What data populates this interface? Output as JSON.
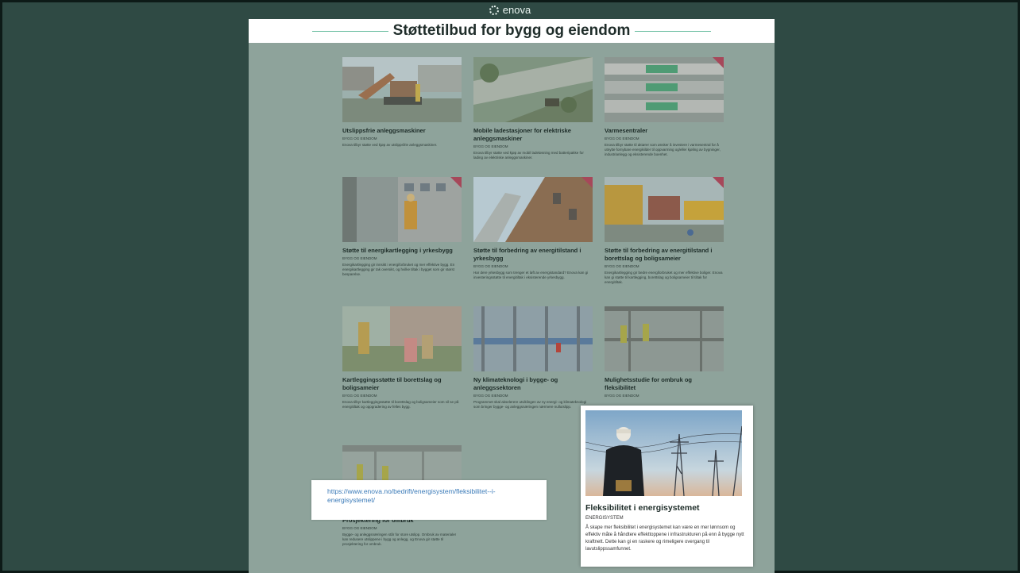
{
  "brand": {
    "name": "enova"
  },
  "page": {
    "title": "Støttetilbud for bygg og eiendom"
  },
  "cards": [
    {
      "title": "Utslippsfrie anleggsmaskiner",
      "category": "BYGG OG EIENDOM",
      "description": "Enova tilbyr støtte ved kjøp av utslippsfrie anleggsmaskiner."
    },
    {
      "title": "Mobile ladestasjoner for elektriske anleggsmaskiner",
      "category": "BYGG OG EIENDOM",
      "description": "Enova tilbyr støtte ved kjøp av mobil ladeløsning med batteripakke for lading av elektriske anleggsmaskiner."
    },
    {
      "title": "Varmesentraler",
      "category": "BYGG OG EIENDOM",
      "description": "Enova tilbyr støtte til aktører som ønsker å investere i varmesentral for å utnytte fornybare energikilder til oppvarming og/eller kjøling av bygninger, industrianlegg og eksisterende boenhet."
    },
    {
      "title": "Støtte til energikartlegging i yrkesbygg",
      "category": "BYGG OG EIENDOM",
      "description": "Energikartlegging gir innsikt i energiforbruket og mer effektive bygg. En energikartlegging gir tak oversikt, og hvilke tiltak i bygget som gir størst besparelse."
    },
    {
      "title": "Støtte til forbedring av energitilstand i yrkesbygg",
      "category": "BYGG OG EIENDOM",
      "description": "Har dere yrkesbygg som trenger et løft av energistandard? Enova kan gi investeringsstøtte til energitiltak i eksisterende yrkesbygg."
    },
    {
      "title": "Støtte til forbedring av energitilstand i borettslag og boligsameier",
      "category": "BYGG OG EIENDOM",
      "description": "Energikartlegging gir bedre energiforbruket og mer effektive boliger. Enova kan gi støtte til kartlegging, borettslag og boligsameier til tiltak for energitiltak."
    },
    {
      "title": "Kartleggingsstøtte til borettslag og boligsameier",
      "category": "BYGG OG EIENDOM",
      "description": "Enova tilbyr kartleggingsstøtte til borettslag og boligsameier som vil se på energitiltak og oppgradering av felles bygg."
    },
    {
      "title": "Ny klimateknologi i bygge- og anleggssektoren",
      "category": "BYGG OG EIENDOM",
      "description": "Programmet skal akselerere utviklingen av ny energi- og klimateknologi som bringer bygge- og anleggsnæringen nærmere nullutslipp."
    },
    {
      "title": "Mulighetsstudie for ombruk og fleksibilitet",
      "category": "BYGG OG EIENDOM",
      "description": ""
    },
    {
      "title": "Prosjektering for ombruk",
      "category": "BYGG OG EIENDOM",
      "description": "Bygge- og anleggsnæringen står for store utslipp. Ombruk av materialer kan redusere utslippene i bygg og anlegg, og Enova gir støtte til prosjektering for ombruk."
    }
  ],
  "popup": {
    "title": "Fleksibilitet i energisystemet",
    "category": "ENERGISYSTEM",
    "description": "Å skape mer fleksibilitet i energisystemet kan være en mer lønnsom og effektiv måte å håndtere effekttoppene i infrastrukturen på enn å bygge nytt kraftnett. Dette kan gi en raskere og rimeligere overgang til lavutslippssamfunnet."
  },
  "statusbar": {
    "url": "https://www.enova.no/bedrift/energisystem/fleksibilitet--i-energisystemet/"
  },
  "colors": {
    "background": "#2f4a44",
    "page": "#8ea39b",
    "badge": "#a6485a",
    "link": "#3a7ab8",
    "accent": "#6dbfa2"
  }
}
